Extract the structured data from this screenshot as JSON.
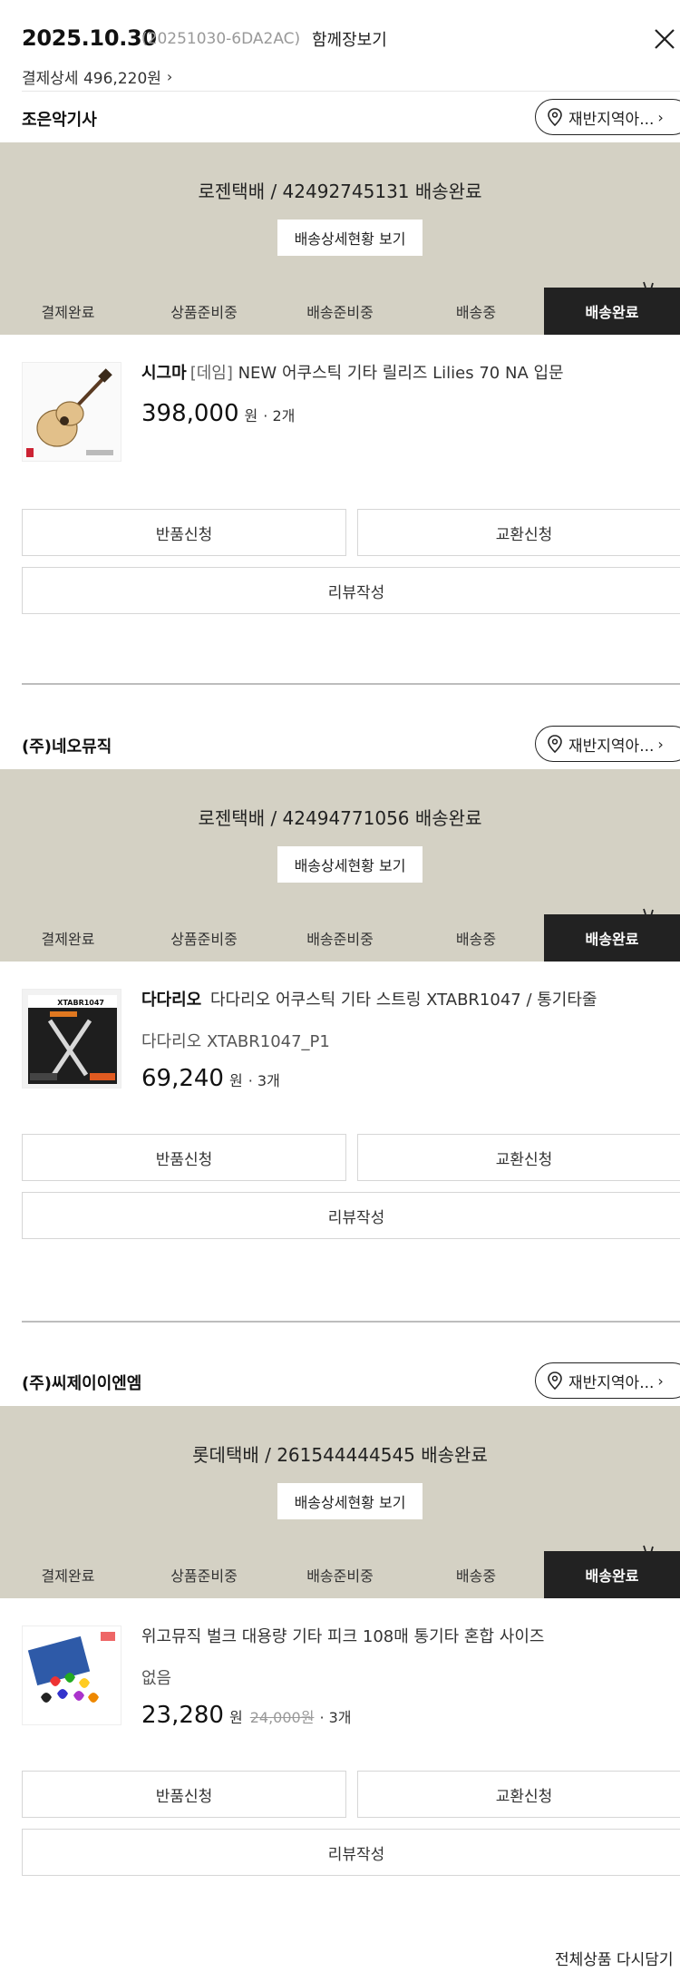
{
  "header": {
    "date": "2025.10.30",
    "order_id": "(20251030-6DA2AC)",
    "group_label": "함께장보기",
    "pay_detail_label": "결제상세",
    "pay_amount": "496,220원",
    "close_icon": "close-icon"
  },
  "steps": [
    "결제완료",
    "상품준비중",
    "배송준비중",
    "배송중",
    "배송완료"
  ],
  "active_step": 4,
  "common": {
    "region_label": "재반지역아...",
    "ship_detail_label": "배송상세현황 보기",
    "return_label": "반품신청",
    "exchange_label": "교환신청",
    "review_label": "리뷰작성"
  },
  "sellers": [
    {
      "name": "조은악기사",
      "shipping": "로젠택배 / 42492745131 배송완료",
      "product": {
        "brand": "시그마",
        "tag": "[데임]",
        "title": "NEW 어쿠스틱 기타 릴리즈 Lilies 70 NA 입문",
        "option": "",
        "price": "398,000",
        "won": "원",
        "orig_price": "",
        "qty": "· 2개",
        "image": "acoustic-guitar"
      }
    },
    {
      "name": "(주)네오뮤직",
      "shipping": "로젠택배 / 42494771056 배송완료",
      "product": {
        "brand": "다다리오",
        "tag": "",
        "title": "다다리오 어쿠스틱 기타 스트링 XTABR1047 / 통기타줄",
        "option": "다다리오 XTABR1047_P1",
        "price": "69,240",
        "won": "원",
        "orig_price": "",
        "qty": "· 3개",
        "image": "guitar-strings-pack",
        "image_text": "XTABR1047"
      }
    },
    {
      "name": "(주)씨제이이엔엠",
      "shipping": "롯데택배 / 261544444545 배송완료",
      "product": {
        "brand": "",
        "tag": "",
        "title": "위고뮤직 벌크 대용량 기타 피크 108매 통기타 혼합 사이즈",
        "option": "없음",
        "price": "23,280",
        "won": "원",
        "orig_price": "24,000원",
        "qty": "· 3개",
        "image": "guitar-picks-bulk"
      }
    }
  ],
  "footer": {
    "reorder_label": "전체상품 다시담기 ›"
  },
  "colors": {
    "ship_bg": "#d4d1c4",
    "active_step_bg": "#222222",
    "box_color": "#d9b276"
  }
}
